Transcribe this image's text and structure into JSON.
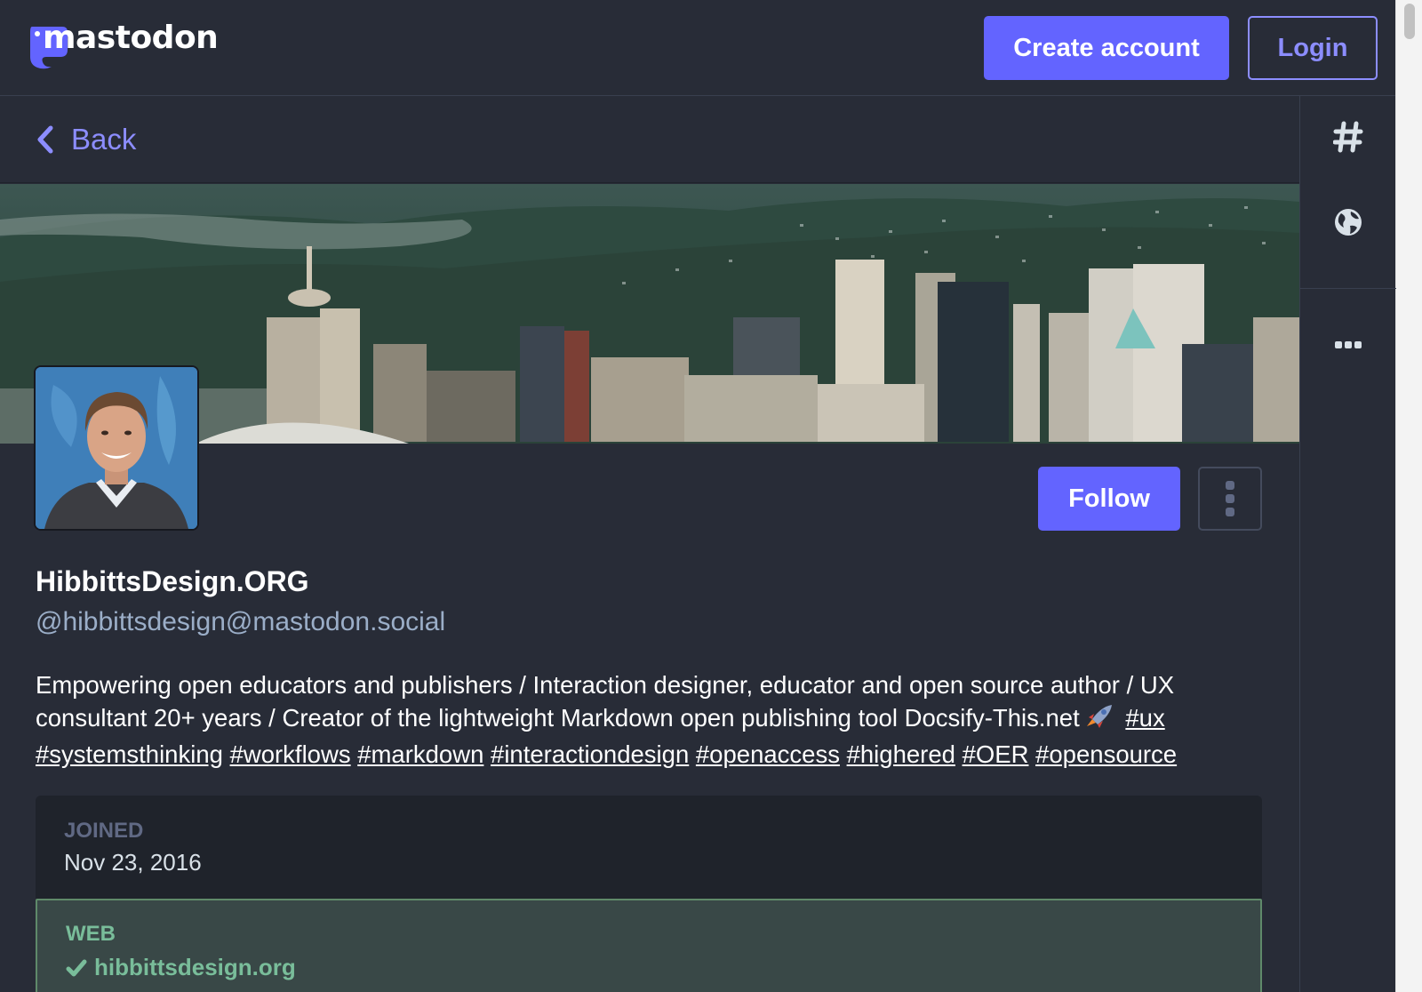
{
  "app": {
    "logo_text": "mastodon"
  },
  "topbar": {
    "create_account_label": "Create account",
    "login_label": "Login"
  },
  "nav": {
    "back_label": "Back"
  },
  "profile": {
    "display_name": "HibbittsDesign.ORG",
    "handle": "@hibbittsdesign@mastodon.social",
    "follow_label": "Follow",
    "bio_text_1": "Empowering open educators and publishers / Interaction designer, educator and open source author / UX consultant 20+ years / Creator of the lightweight Markdown open publishing tool Docsify-This.net",
    "bio_hashtags": [
      "#ux",
      "#systemsthinking",
      "#workflows",
      "#markdown",
      "#interactiondesign",
      "#openaccess",
      "#highered",
      "#OER",
      "#opensource"
    ]
  },
  "fields": {
    "joined_label": "JOINED",
    "joined_value": "Nov 23, 2016",
    "web_label": "WEB",
    "web_value": "hibbittsdesign.org"
  },
  "icons": {
    "logo": "mastodon-logo-icon",
    "back": "chevron-left-icon",
    "hashtag": "hashtag-icon",
    "globe": "globe-icon",
    "more": "ellipsis-icon",
    "account_menu": "vertical-ellipsis-icon",
    "verified": "checkmark-icon",
    "rocket": "rocket-emoji-icon"
  },
  "colors": {
    "accent": "#6364ff",
    "accent_light": "#8c8dff",
    "background": "#282c37",
    "panel": "#1f232b",
    "verified_green": "#79bd9a",
    "muted_text": "#9baec8"
  }
}
